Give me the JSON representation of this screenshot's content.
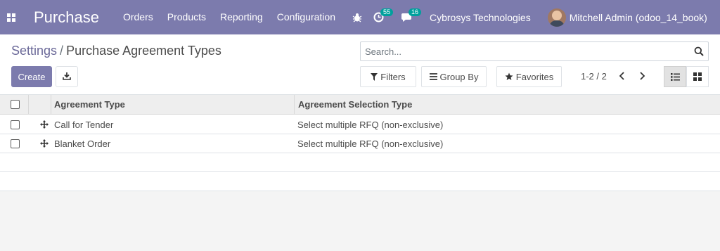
{
  "navbar": {
    "app_name": "Purchase",
    "menu": [
      "Orders",
      "Products",
      "Reporting",
      "Configuration"
    ],
    "activity_count": "55",
    "messages_count": "16",
    "company": "Cybrosys Technologies",
    "user": "Mitchell Admin (odoo_14_book)",
    "color": "#7c7bad"
  },
  "breadcrumb": {
    "parent": "Settings",
    "separator": "/",
    "current": "Purchase Agreement Types"
  },
  "search": {
    "placeholder": "Search..."
  },
  "buttons": {
    "create": "Create",
    "filters": "Filters",
    "group_by": "Group By",
    "favorites": "Favorites"
  },
  "pager": {
    "value": "1-2 / 2"
  },
  "table": {
    "columns": [
      "Agreement Type",
      "Agreement Selection Type"
    ],
    "rows": [
      {
        "type": "Call for Tender",
        "selection": "Select multiple RFQ (non-exclusive)"
      },
      {
        "type": "Blanket Order",
        "selection": "Select multiple RFQ (non-exclusive)"
      }
    ]
  },
  "icons": {
    "apps": "apps-grid-icon",
    "debug": "bug-icon",
    "activity": "clock-icon",
    "messages": "chat-icon",
    "search": "search-icon",
    "download": "download-icon",
    "filter": "filter-icon",
    "group_by": "list-icon",
    "favorites": "star-icon",
    "prev": "chevron-left-icon",
    "next": "chevron-right-icon",
    "list_view": "list-view-icon",
    "kanban_view": "kanban-view-icon",
    "drag": "drag-handle-icon"
  }
}
